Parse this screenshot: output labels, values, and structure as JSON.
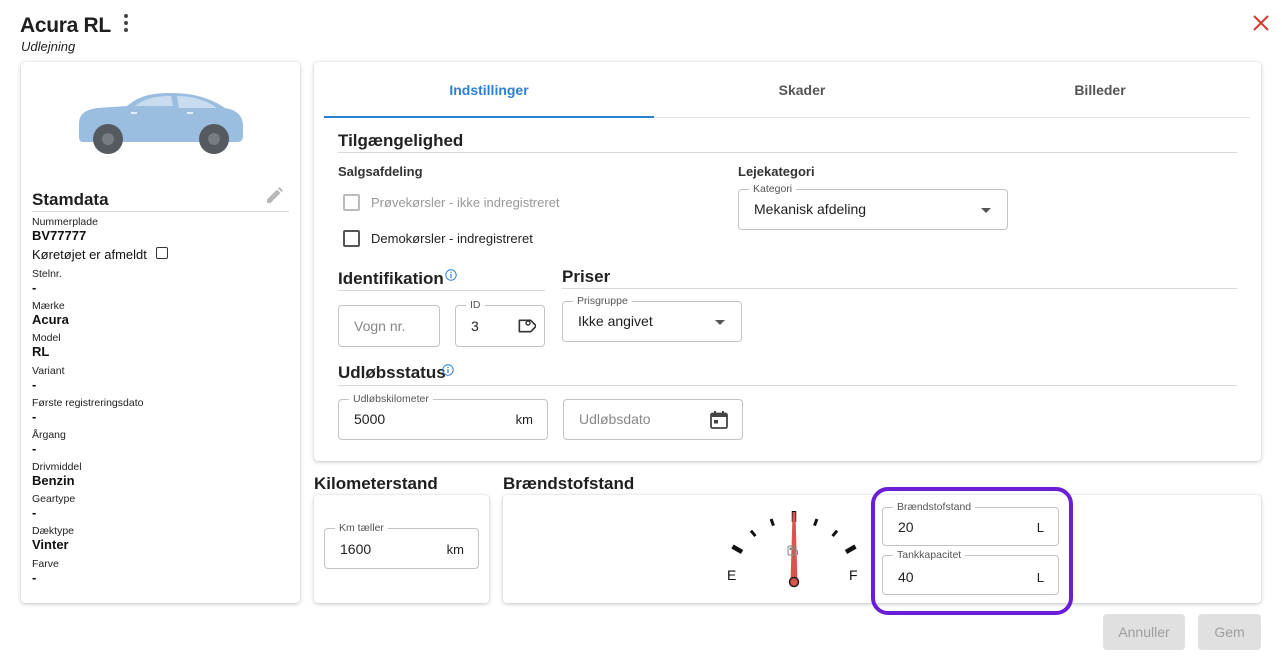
{
  "header": {
    "title": "Acura RL",
    "subtitle": "Udlejning"
  },
  "stamdata": {
    "title": "Stamdata",
    "fields": [
      {
        "label": "Nummerplade",
        "value": "BV77777"
      },
      {
        "label": "Stelnr.",
        "value": "-"
      },
      {
        "label": "Mærke",
        "value": "Acura"
      },
      {
        "label": "Model",
        "value": "RL"
      },
      {
        "label": "Variant",
        "value": "-"
      },
      {
        "label": "Første registreringsdato",
        "value": "-"
      },
      {
        "label": "Årgang",
        "value": "-"
      },
      {
        "label": "Drivmiddel",
        "value": "Benzin"
      },
      {
        "label": "Geartype",
        "value": "-"
      },
      {
        "label": "Dæktype",
        "value": "Vinter"
      },
      {
        "label": "Farve",
        "value": "-"
      }
    ],
    "afmeldt_label": "Køretøjet er afmeldt",
    "afmeldt_checked": false
  },
  "tabs": [
    {
      "label": "Indstillinger",
      "active": true
    },
    {
      "label": "Skader",
      "active": false
    },
    {
      "label": "Billeder",
      "active": false
    }
  ],
  "tilgaengelighed": {
    "title": "Tilgængelighed",
    "salgsafdeling": {
      "title": "Salgsafdeling",
      "options": [
        {
          "label": "Prøvekørsler - ikke indregistreret",
          "checked": false,
          "disabled": true
        },
        {
          "label": "Demokørsler - indregistreret",
          "checked": false,
          "disabled": false
        }
      ]
    },
    "lejekategori": {
      "title": "Lejekategori",
      "field_label": "Kategori",
      "value": "Mekanisk afdeling"
    }
  },
  "identifikation": {
    "title": "Identifikation",
    "vogn_placeholder": "Vogn nr.",
    "id_label": "ID",
    "id_value": "3"
  },
  "priser": {
    "title": "Priser",
    "field_label": "Prisgruppe",
    "value": "Ikke angivet"
  },
  "udloebsstatus": {
    "title": "Udløbsstatus",
    "km_label": "Udløbskilometer",
    "km_value": "5000",
    "km_unit": "km",
    "dato_placeholder": "Udløbsdato"
  },
  "kilometerstand": {
    "title": "Kilometerstand",
    "field_label": "Km tæller",
    "value": "1600",
    "unit": "km"
  },
  "braendstof": {
    "title": "Brændstofstand",
    "gauge": {
      "empty_label": "E",
      "full_label": "F",
      "level_fraction": 0.5
    },
    "level_label": "Brændstofstand",
    "level_value": "20",
    "level_unit": "L",
    "capacity_label": "Tankkapacitet",
    "capacity_value": "40",
    "capacity_unit": "L"
  },
  "actions": {
    "cancel": "Annuller",
    "save": "Gem"
  },
  "colors": {
    "accent": "#2b7fd4",
    "highlight": "#6a1fd6",
    "close": "#d33b32",
    "needle": "#d9534f",
    "car_body": "#9bbde0"
  }
}
